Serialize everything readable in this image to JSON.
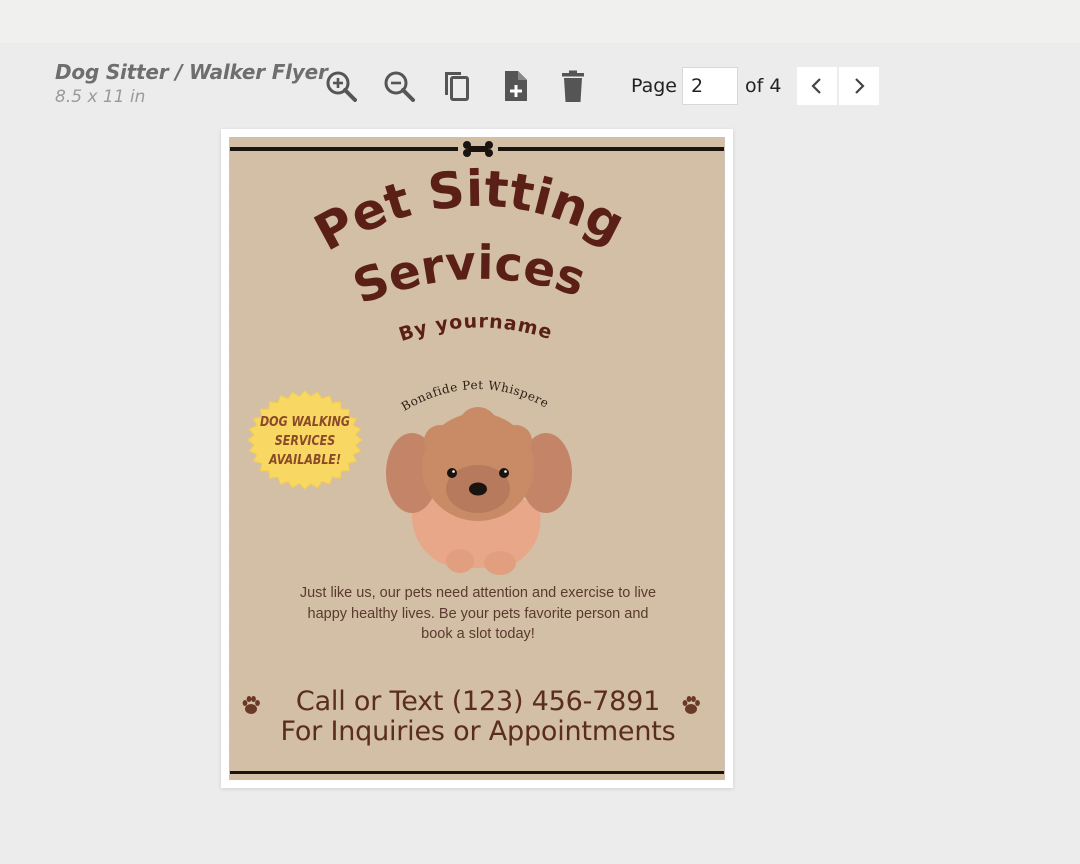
{
  "document": {
    "title": "Dog Sitter / Walker Flyer",
    "size": "8.5 x 11 in"
  },
  "toolbar": {
    "icons": [
      "zoom-in-icon",
      "zoom-out-icon",
      "copy-page-icon",
      "add-page-icon",
      "delete-page-icon"
    ]
  },
  "pager": {
    "page_label": "Page",
    "current_page": "2",
    "of_label": "of 4",
    "prev_icon": "chevron-left-icon",
    "next_icon": "chevron-right-icon"
  },
  "flyer": {
    "headline_line1": "Pet Sitting",
    "headline_line2": "Services",
    "byline": "By yourname",
    "dog_caption": "Bonafide Pet Whisperer",
    "badge": "DOG WALKING SERVICES AVAILABLE!",
    "tagline": "Just like us, our pets need attention and exercise to live happy healthy lives. Be your pets favorite person and book a slot today!",
    "call_line": "Call or Text (123) 456-7891",
    "inquiries_line": "For Inquiries or Appointments"
  },
  "colors": {
    "flyer_background": "#d3bfa6",
    "headline": "#5a2017",
    "badge_fill": "#f8d762",
    "badge_text": "#8a4a2a",
    "dog_fur": "#c98a66",
    "dog_body": "#e8a788"
  }
}
